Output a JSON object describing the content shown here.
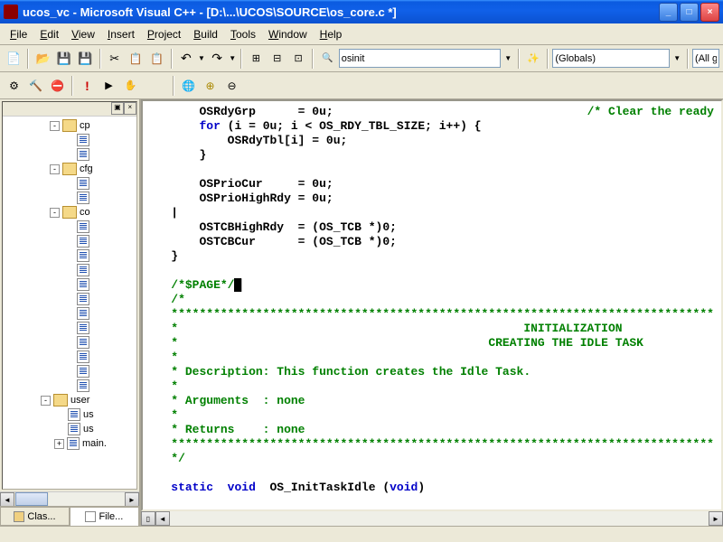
{
  "title": "ucos_vc - Microsoft Visual C++ - [D:\\...\\UCOS\\SOURCE\\os_core.c *]",
  "menu": {
    "file": "File",
    "edit": "Edit",
    "view": "View",
    "insert": "Insert",
    "project": "Project",
    "build": "Build",
    "tools": "Tools",
    "window": "Window",
    "help": "Help"
  },
  "toolbar": {
    "combo_find": "osinit",
    "combo_scope": "(Globals)",
    "combo_extra": "(All g"
  },
  "tree": {
    "folders": [
      "cp",
      "cfg",
      "co",
      "user"
    ],
    "user_files": [
      "us",
      "us"
    ],
    "main_file": "main."
  },
  "sidebar_tabs": {
    "class": "Clas...",
    "file": "File..."
  },
  "code": {
    "l1a": "       OSRdyGrp      = ",
    "l1b": "0u",
    "l1c": ";                                    ",
    "l1d": "/* Clear the ready",
    "l2a": "       for",
    "l2b": " (i = ",
    "l2c": "0u",
    "l2d": "; i < OS_RDY_TBL_SIZE; i++) {",
    "l3a": "           OSRdyTbl[i] = ",
    "l3b": "0u",
    "l3c": ";",
    "l4": "       }",
    "l5": "",
    "l6a": "       OSPrioCur     = ",
    "l6b": "0u",
    "l6c": ";",
    "l7a": "       OSPrioHighRdy = ",
    "l7b": "0u",
    "l7c": ";",
    "l8": "   |",
    "l9a": "       OSTCBHighRdy  = (OS_TCB *)",
    "l9b": "0",
    "l9c": ";",
    "l10a": "       OSTCBCur      = (OS_TCB *)",
    "l10b": "0",
    "l10c": ";",
    "l11": "   }",
    "l12": "",
    "l13": "   /*$PAGE*/",
    "l14": "   /*",
    "l15": "   *****************************************************************************",
    "l16": "   *                                                 INITIALIZATION",
    "l17": "   *                                            CREATING THE IDLE TASK",
    "l18": "   *",
    "l19": "   * Description: This function creates the Idle Task.",
    "l20": "   *",
    "l21": "   * Arguments  : none",
    "l22": "   *",
    "l23": "   * Returns    : none",
    "l24": "   *****************************************************************************",
    "l25": "   */",
    "l26": "",
    "l27a": "   static  void",
    "l27b": "  OS_InitTaskIdle (",
    "l27c": "void",
    "l27d": ")"
  }
}
